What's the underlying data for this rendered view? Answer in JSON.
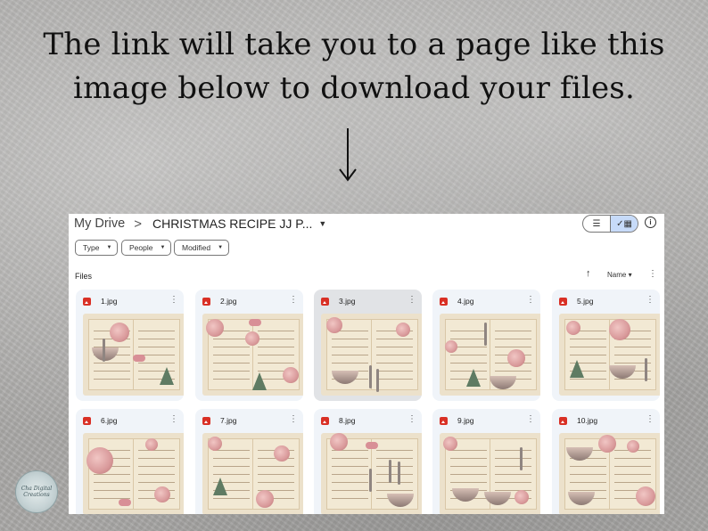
{
  "headline": {
    "line1": "The link will take you to a page like this",
    "line2": "image below to download your files."
  },
  "drive": {
    "breadcrumb_root": "My Drive",
    "breadcrumb_separator": ">",
    "breadcrumb_current": "CHRISTMAS RECIPE JJ P...",
    "filters": [
      "Type",
      "People",
      "Modified"
    ],
    "section_label": "Files",
    "sort_label": "Name",
    "files": [
      "1.jpg",
      "2.jpg",
      "3.jpg",
      "4.jpg",
      "5.jpg",
      "6.jpg",
      "7.jpg",
      "8.jpg",
      "9.jpg",
      "10.jpg"
    ],
    "selected_file": "3.jpg"
  },
  "icons": {
    "dropdown": "triangle-down",
    "file_type": "image-file-red",
    "more": "vertical-dots",
    "list_view": "hamburger",
    "grid_view": "check-grid",
    "info": "info-circle",
    "sort": "arrow-up"
  },
  "colors": {
    "accent": "#c7dbf9",
    "file_icon": "#d93025",
    "card_bg": "#f0f4f9"
  },
  "logo": {
    "text": "Cha Digital Creations"
  }
}
